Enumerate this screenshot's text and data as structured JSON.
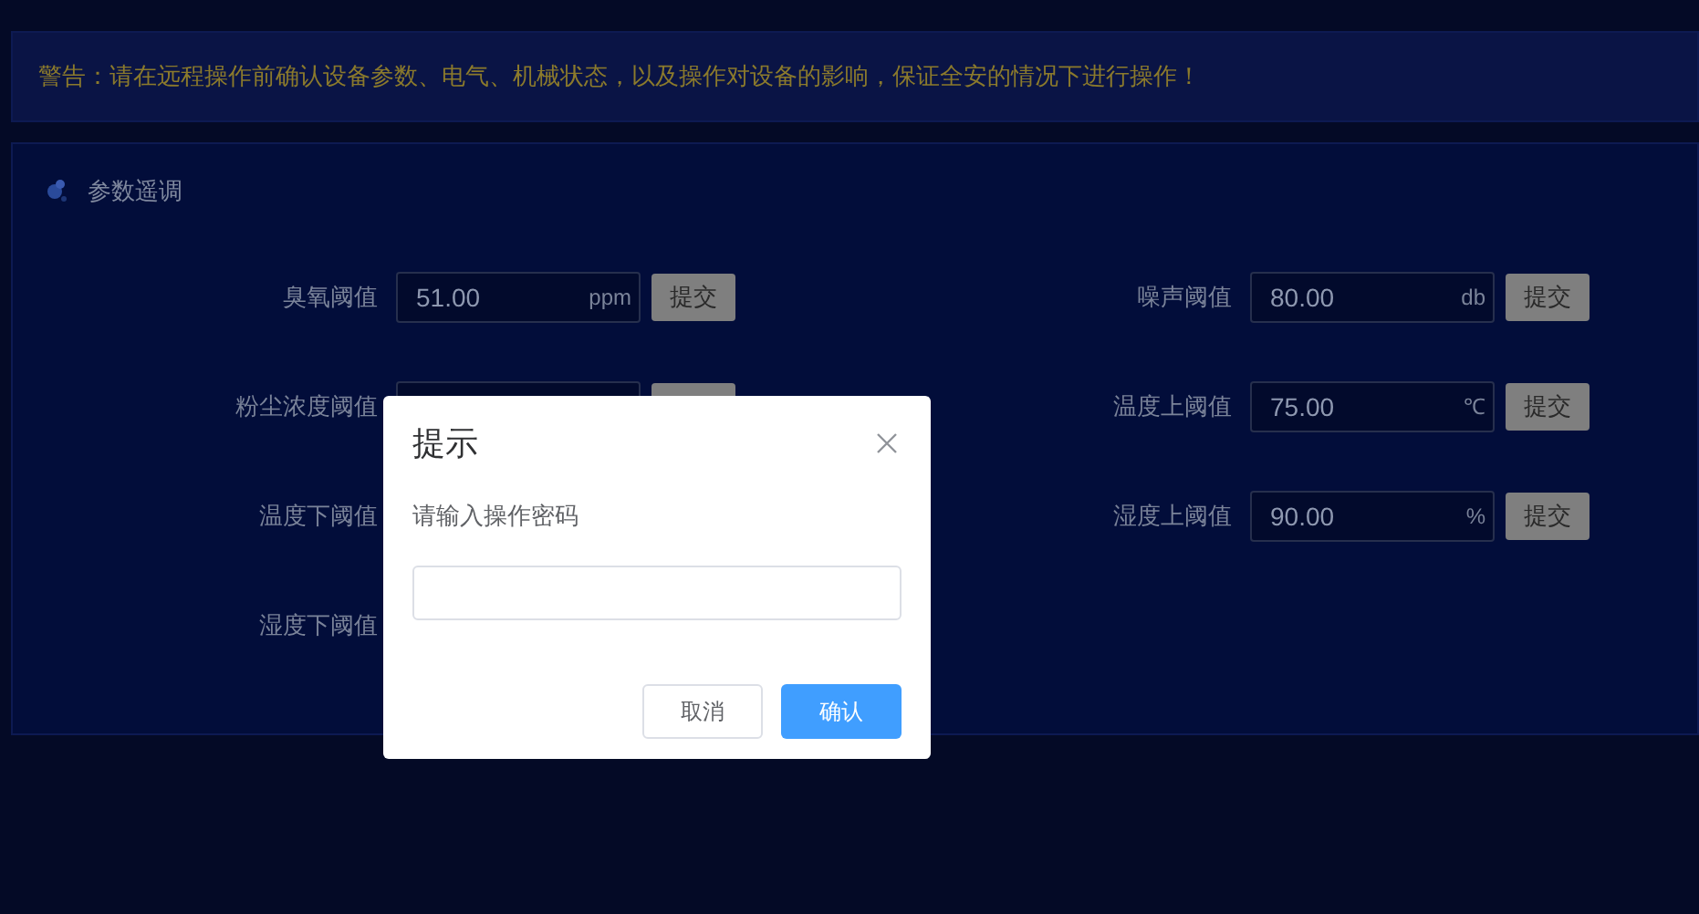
{
  "warning": "警告：请在远程操作前确认设备参数、电气、机械状态，以及操作对设备的影响，保证全安的情况下进行操作！",
  "panel": {
    "title": "参数遥调",
    "left_fields": [
      {
        "label": "臭氧阈值",
        "value": "51.00",
        "unit": "ppm",
        "button": "提交"
      },
      {
        "label": "粉尘浓度阈值",
        "kind": "covered"
      },
      {
        "label": "温度下阈值"
      },
      {
        "label": "湿度下阈值"
      }
    ],
    "right_fields": [
      {
        "label": "噪声阈值",
        "value": "80.00",
        "unit": "db",
        "button": "提交"
      },
      {
        "label": "温度上阈值",
        "value": "75.00",
        "unit": "℃",
        "button": "提交"
      },
      {
        "label": "湿度上阈值",
        "value": "90.00",
        "unit": "%",
        "button": "提交"
      }
    ]
  },
  "dialog": {
    "title": "提示",
    "message": "请输入操作密码",
    "buttons": [
      {
        "label": "取消",
        "kind": "secondary"
      },
      {
        "label": "确认",
        "kind": "primary"
      }
    ]
  }
}
